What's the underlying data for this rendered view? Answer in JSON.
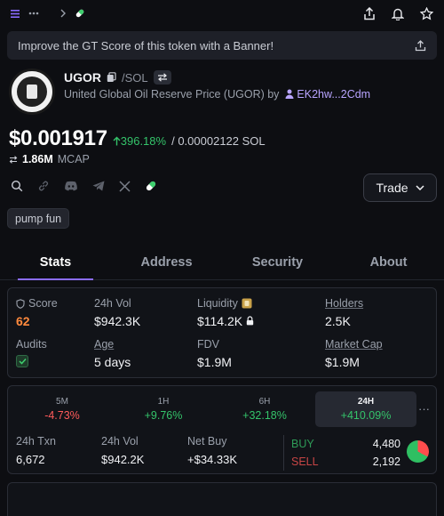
{
  "banner": {
    "text": "Improve the GT Score of this token with a Banner!"
  },
  "token": {
    "symbol": "UGOR",
    "pair": "/SOL",
    "full_name": "United Global Oil Reserve Price (UGOR) by",
    "creator": "EK2hw...2Cdm"
  },
  "price": {
    "usd": "$0.001917",
    "change": "396.18%",
    "sol_sep": "/",
    "sol": "0.00002122 SOL"
  },
  "mcap": {
    "value": "1.86M",
    "label": "MCAP"
  },
  "trade_button": {
    "label": "Trade"
  },
  "tag": {
    "label": "pump fun"
  },
  "tabs": [
    {
      "label": "Stats"
    },
    {
      "label": "Address"
    },
    {
      "label": "Security"
    },
    {
      "label": "About"
    }
  ],
  "stats": {
    "score": {
      "label": "Score",
      "value": "62"
    },
    "vol24": {
      "label": "24h Vol",
      "value": "$942.3K"
    },
    "liquidity": {
      "label": "Liquidity",
      "value": "$114.2K"
    },
    "holders": {
      "label": "Holders",
      "value": "2.5K"
    },
    "audits": {
      "label": "Audits"
    },
    "age": {
      "label": "Age",
      "value": "5 days"
    },
    "fdv": {
      "label": "FDV",
      "value": "$1.9M"
    },
    "market_cap": {
      "label": "Market Cap",
      "value": "$1.9M"
    }
  },
  "periods": [
    {
      "label": "5M",
      "value": "-4.73%"
    },
    {
      "label": "1H",
      "value": "+9.76%"
    },
    {
      "label": "6H",
      "value": "+32.18%"
    },
    {
      "label": "24H",
      "value": "+410.09%"
    }
  ],
  "more_label": "···",
  "tx": {
    "txn": {
      "label": "24h Txn",
      "value": "6,672"
    },
    "vol": {
      "label": "24h Vol",
      "value": "$942.2K"
    },
    "net_buy": {
      "label": "Net Buy",
      "value": "+$34.33K"
    },
    "buy": {
      "label": "BUY",
      "value": "4,480"
    },
    "sell": {
      "label": "SELL",
      "value": "2,192"
    }
  },
  "colors": {
    "accent": "#8b6cff",
    "green": "#34c36a",
    "red": "#ff5b5b",
    "score": "#ff8a3d"
  }
}
